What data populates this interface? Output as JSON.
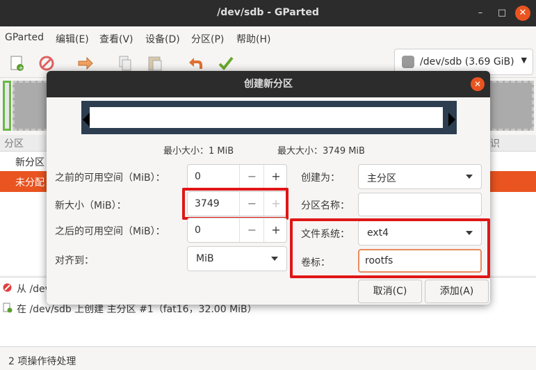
{
  "window": {
    "title": "/dev/sdb - GParted",
    "minimize": "–",
    "maximize": "□",
    "close": "✕"
  },
  "menu": [
    "GParted",
    "编辑(E)",
    "查看(V)",
    "设备(D)",
    "分区(P)",
    "帮助(H)"
  ],
  "device": {
    "label": "/dev/sdb (3.69 GiB)"
  },
  "list": {
    "header_partition": "分区",
    "header_flags": "识",
    "row1": "新分区",
    "row2": "未分配"
  },
  "operations": {
    "op1": "从 /dev",
    "op2": "在 /dev/sdb 上创建 主分区 #1（fat16，32.00 MiB）"
  },
  "status": "2 项操作待处理",
  "dialog": {
    "title": "创建新分区",
    "close": "✕",
    "min_size": "最小大小：1 MiB",
    "max_size": "最大大小：3749 MiB",
    "free_before_label": "之前的可用空间（MiB）：",
    "free_before_value": "0",
    "new_size_label": "新大小（MiB）：",
    "new_size_value": "3749",
    "free_after_label": "之后的可用空间（MiB）：",
    "free_after_value": "0",
    "align_label": "对齐到：",
    "align_value": "MiB",
    "create_as_label": "创建为：",
    "create_as_value": "主分区",
    "partition_name_label": "分区名称：",
    "partition_name_value": "",
    "filesystem_label": "文件系统：",
    "filesystem_value": "ext4",
    "volume_label_label": "卷标：",
    "volume_label_value": "rootfs",
    "cancel": "取消(C)",
    "add": "添加(A)",
    "minus": "−",
    "plus": "+"
  },
  "colors": {
    "accent": "#e95420",
    "highlight": "#e01616",
    "titlebar": "#2c2c2c"
  }
}
